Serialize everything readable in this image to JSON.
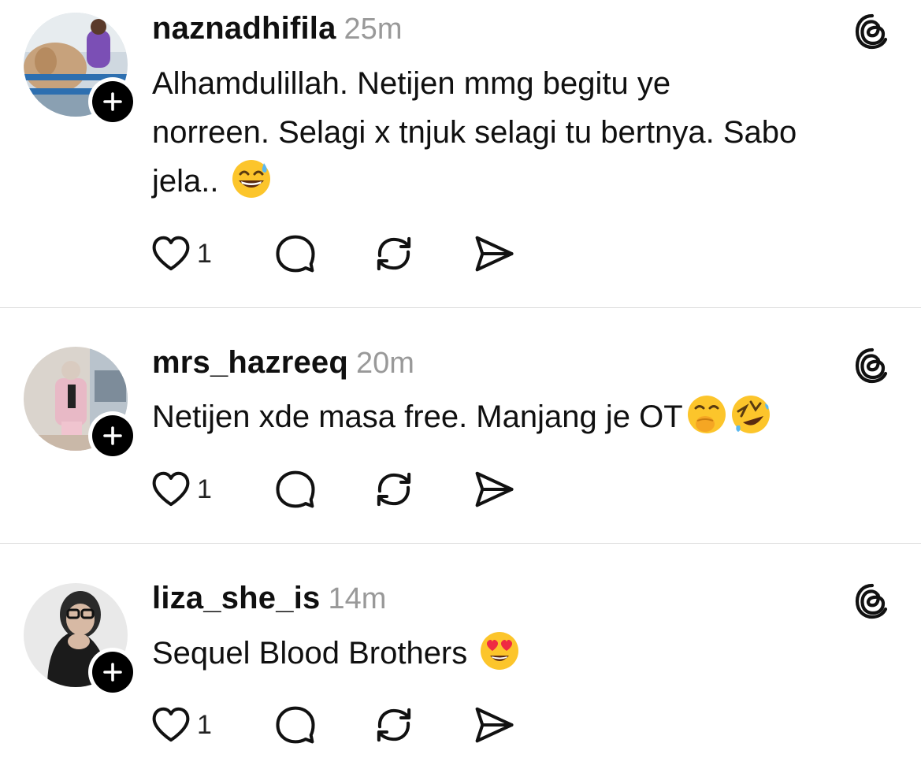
{
  "posts": [
    {
      "username": "naznadhifila",
      "time": "25m",
      "text_lines": [
        "Alhamdulillah. Netijen mmg begitu ye",
        "norreen. Selagi x tnjuk selagi tu bertnya. Sabo",
        "jela.. "
      ],
      "emojis": [
        "grinning-sweat-emoji"
      ],
      "like_count": "1"
    },
    {
      "username": "mrs_hazreeq",
      "time": "20m",
      "text_lines": [
        "Netijen xde masa free. Manjang je OT"
      ],
      "emojis": [
        "hand-over-mouth-emoji",
        "rolling-laughing-emoji"
      ],
      "like_count": "1"
    },
    {
      "username": "liza_she_is",
      "time": "14m",
      "text_lines": [
        "Sequel Blood Brothers "
      ],
      "emojis": [
        "heart-eyes-emoji"
      ],
      "like_count": "1"
    }
  ],
  "icons": {
    "like": "heart-outline-icon",
    "reply": "speech-bubble-icon",
    "repost": "repost-arrows-icon",
    "share": "send-icon",
    "threads": "threads-logo-icon",
    "follow": "plus-icon"
  }
}
